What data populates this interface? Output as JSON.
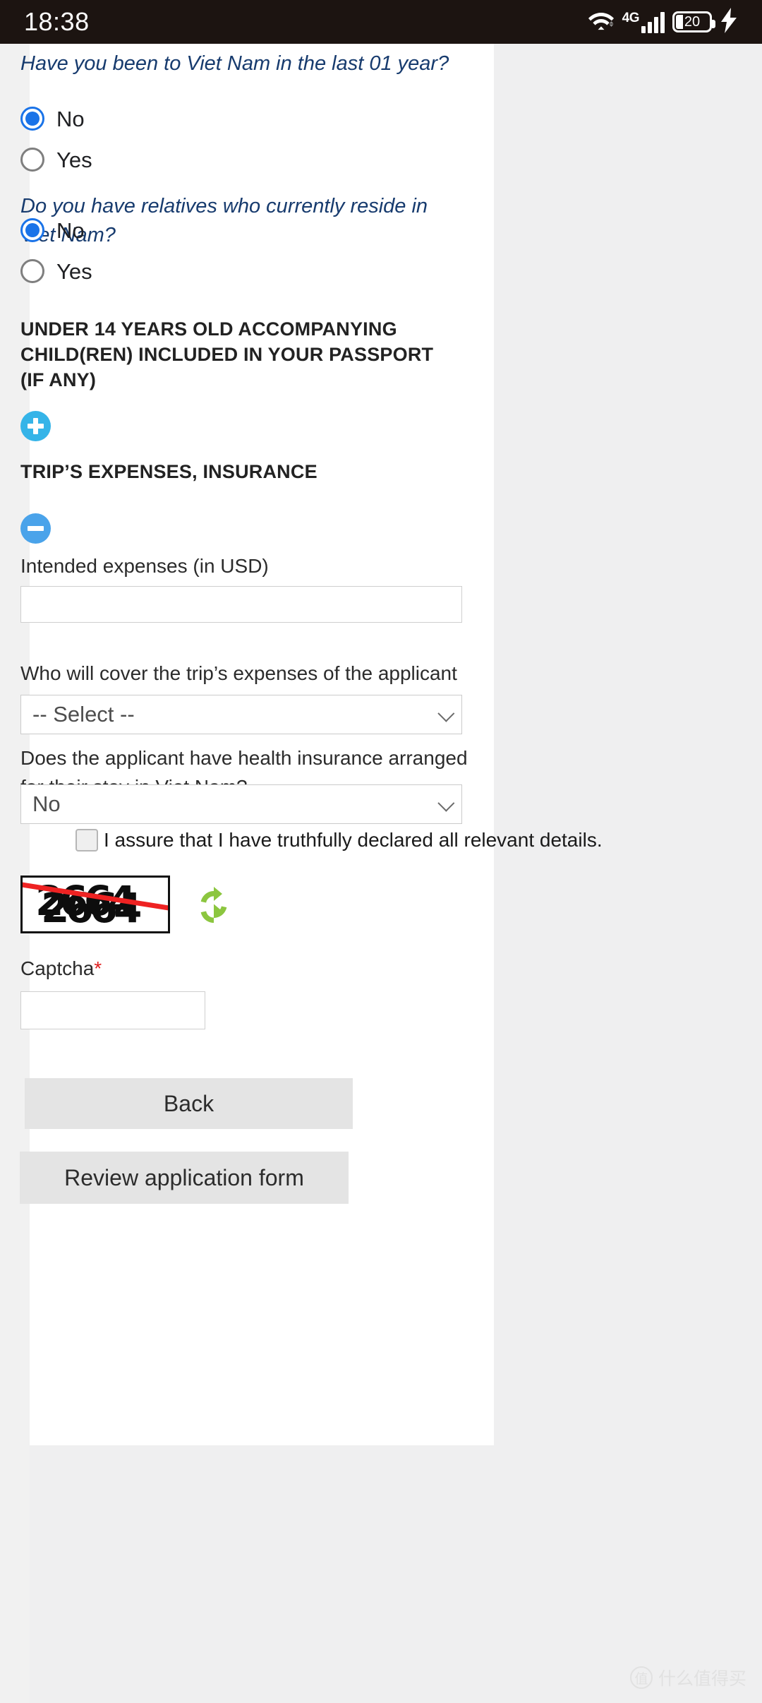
{
  "status_bar": {
    "time": "18:38",
    "network_label": "4G",
    "battery_level": "20",
    "icons": [
      "wifi-icon",
      "signal-bars-icon",
      "battery-icon",
      "charging-bolt-icon"
    ]
  },
  "form": {
    "questions": [
      {
        "text": "Have you been to Viet Nam in the last 01 year?",
        "options": [
          "No",
          "Yes"
        ],
        "selected": "No"
      },
      {
        "text": "Do you have relatives who currently reside in Viet Nam?",
        "options": [
          "No",
          "Yes"
        ],
        "selected": "No"
      }
    ],
    "sections": [
      {
        "title": "UNDER 14 YEARS OLD ACCOMPANYING CHILD(REN) INCLUDED IN YOUR PASSPORT (IF ANY)",
        "toggle": "plus-icon"
      },
      {
        "title": "TRIP’S EXPENSES, INSURANCE",
        "toggle": "minus-icon"
      }
    ],
    "expenses": {
      "label": "Intended expenses (in USD)",
      "value": "",
      "placeholder": ""
    },
    "cover_expenses": {
      "label": "Who will cover the trip’s expenses of the applicant",
      "value": "-- Select --"
    },
    "health_insurance": {
      "label": "Does the applicant have health insurance arranged for their stay in Viet Nam?",
      "value": "No"
    },
    "assurance": {
      "label": "I assure that I have truthfully declared all relevant details.",
      "checked": false
    },
    "captcha": {
      "image_text": "2664",
      "refresh_icon": "refresh-icon",
      "label": "Captcha",
      "required_mark": "*",
      "value": "",
      "placeholder": ""
    },
    "buttons": {
      "back": "Back",
      "review": "Review application form"
    }
  },
  "watermark": {
    "badge": "值",
    "text": "什么值得买"
  }
}
